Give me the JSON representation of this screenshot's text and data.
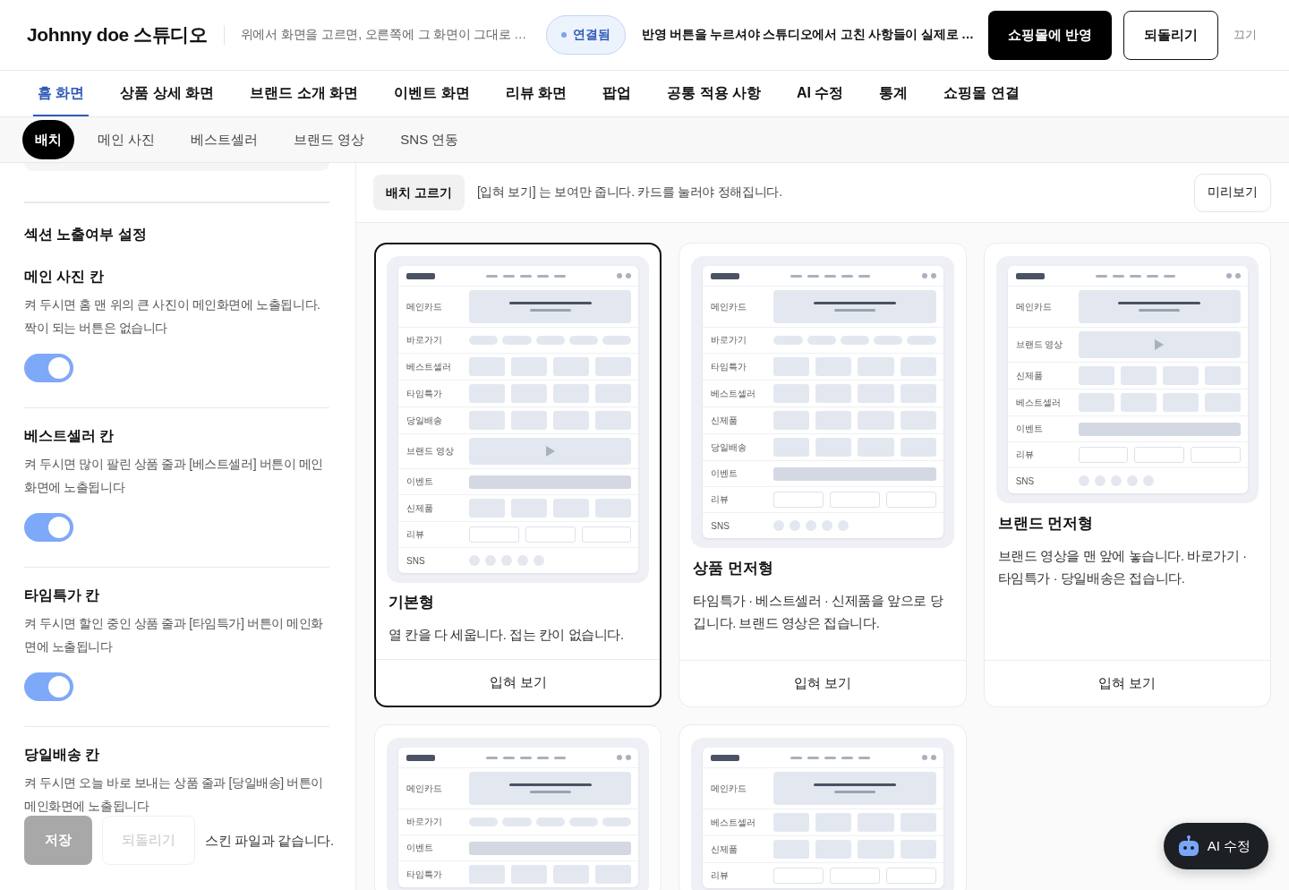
{
  "header": {
    "logo": "Johnny doe 스튜디오",
    "hint": "위에서 화면을 고르면, 오른쪽에 그 화면이 그대로 …",
    "status": {
      "label": "연결됨",
      "connected": true
    },
    "notice": "반영 버튼을 누르셔야 스튜디오에서 고친 사항들이 실제로 …",
    "buttons": [
      {
        "label": "쇼핑몰에 반영",
        "kind": "primary"
      },
      {
        "label": "되돌리기",
        "kind": "outline"
      },
      {
        "label": "끄기",
        "kind": "text"
      }
    ]
  },
  "tabs": [
    {
      "label": "홈 화면",
      "selected": true
    },
    {
      "label": "상품 상세 화면",
      "selected": false
    },
    {
      "label": "브랜드 소개 화면",
      "selected": false
    },
    {
      "label": "이벤트 화면",
      "selected": false
    },
    {
      "label": "리뷰 화면",
      "selected": false
    },
    {
      "label": "팝업",
      "selected": false
    },
    {
      "label": "공통 적용 사항",
      "selected": false
    },
    {
      "label": "AI 수정",
      "selected": false
    },
    {
      "label": "통계",
      "selected": false
    },
    {
      "label": "쇼핑몰 연결",
      "selected": false
    }
  ],
  "subtabs": [
    {
      "label": "배치",
      "selected": true
    },
    {
      "label": "메인 사진",
      "selected": false
    },
    {
      "label": "베스트셀러",
      "selected": false
    },
    {
      "label": "브랜드 영상",
      "selected": false
    },
    {
      "label": "SNS 연동",
      "selected": false
    }
  ],
  "sidebar": {
    "heading": "섹션 노출여부 설정",
    "sections": [
      {
        "title": "메인 사진 칸",
        "description": "켜 두시면 홈 맨 위의 큰 사진이 메인화면에 노출됩니다. 짝이 되는 버튼은 없습니다",
        "on": true
      },
      {
        "title": "베스트셀러 칸",
        "description": "켜 두시면 많이 팔린 상품 줄과 [베스트셀러] 버튼이 메인화면에 노출됩니다",
        "on": true
      },
      {
        "title": "타임특가 칸",
        "description": "켜 두시면 할인 중인 상품 줄과 [타임특가] 버튼이 메인화면에 노출됩니다",
        "on": true
      },
      {
        "title": "당일배송 칸",
        "description": "켜 두시면 오늘 바로 보내는 상품 줄과 [당일배송] 버튼이 메인화면에 노출됩니다"
      }
    ],
    "footer": {
      "buttons": [
        {
          "label": "저장",
          "kind": "primary",
          "disabled": true
        },
        {
          "label": "되돌리기",
          "kind": "secondary",
          "disabled": true
        }
      ],
      "note": "스킨 파일과 같습니다."
    }
  },
  "layout_picker": {
    "label": "배치 고르기",
    "hint": "[입혀 보기] 는 보여만 줍니다. 카드를 눌러야 정해집니다.",
    "preview_button": "미리보기",
    "layouts": [
      {
        "title": "기본형",
        "description": "열 칸을 다 세웁니다. 접는 칸이 없습니다.",
        "action": "입혀 보기",
        "selected": true,
        "rows": [
          {
            "label": "메인카드",
            "kind": "hero"
          },
          {
            "label": "바로가기",
            "kind": "chips"
          },
          {
            "label": "베스트셀러",
            "kind": "grid"
          },
          {
            "label": "타임특가",
            "kind": "grid"
          },
          {
            "label": "당일배송",
            "kind": "grid"
          },
          {
            "label": "브랜드 영상",
            "kind": "video"
          },
          {
            "label": "이벤트",
            "kind": "banner"
          },
          {
            "label": "신제품",
            "kind": "grid"
          },
          {
            "label": "리뷰",
            "kind": "reviews"
          },
          {
            "label": "SNS",
            "kind": "dots"
          }
        ]
      },
      {
        "title": "상품 먼저형",
        "description": "타임특가 · 베스트셀러 · 신제품을 앞으로 당깁니다. 브랜드 영상은 접습니다.",
        "action": "입혀 보기",
        "selected": false,
        "rows": [
          {
            "label": "메인카드",
            "kind": "hero"
          },
          {
            "label": "바로가기",
            "kind": "chips"
          },
          {
            "label": "타임특가",
            "kind": "grid"
          },
          {
            "label": "베스트셀러",
            "kind": "grid"
          },
          {
            "label": "신제품",
            "kind": "grid"
          },
          {
            "label": "당일배송",
            "kind": "grid"
          },
          {
            "label": "이벤트",
            "kind": "banner"
          },
          {
            "label": "리뷰",
            "kind": "reviews"
          },
          {
            "label": "SNS",
            "kind": "dots"
          }
        ]
      },
      {
        "title": "브랜드 먼저형",
        "description": "브랜드 영상을 맨 앞에 놓습니다. 바로가기 · 타임특가 · 당일배송은 접습니다.",
        "action": "입혀 보기",
        "selected": false,
        "rows": [
          {
            "label": "메인카드",
            "kind": "hero"
          },
          {
            "label": "브랜드 영상",
            "kind": "video"
          },
          {
            "label": "신제품",
            "kind": "grid"
          },
          {
            "label": "베스트셀러",
            "kind": "grid"
          },
          {
            "label": "이벤트",
            "kind": "banner"
          },
          {
            "label": "리뷰",
            "kind": "reviews"
          },
          {
            "label": "SNS",
            "kind": "dots"
          }
        ]
      },
      {
        "selected": false,
        "rows": [
          {
            "label": "메인카드",
            "kind": "hero"
          },
          {
            "label": "바로가기",
            "kind": "chips"
          },
          {
            "label": "이벤트",
            "kind": "banner"
          },
          {
            "label": "타임특가",
            "kind": "grid"
          }
        ]
      },
      {
        "selected": false,
        "rows": [
          {
            "label": "메인카드",
            "kind": "hero"
          },
          {
            "label": "베스트셀러",
            "kind": "grid"
          },
          {
            "label": "신제품",
            "kind": "grid"
          },
          {
            "label": "리뷰",
            "kind": "reviews"
          }
        ]
      }
    ]
  },
  "ai_button": {
    "label": "AI 수정"
  }
}
